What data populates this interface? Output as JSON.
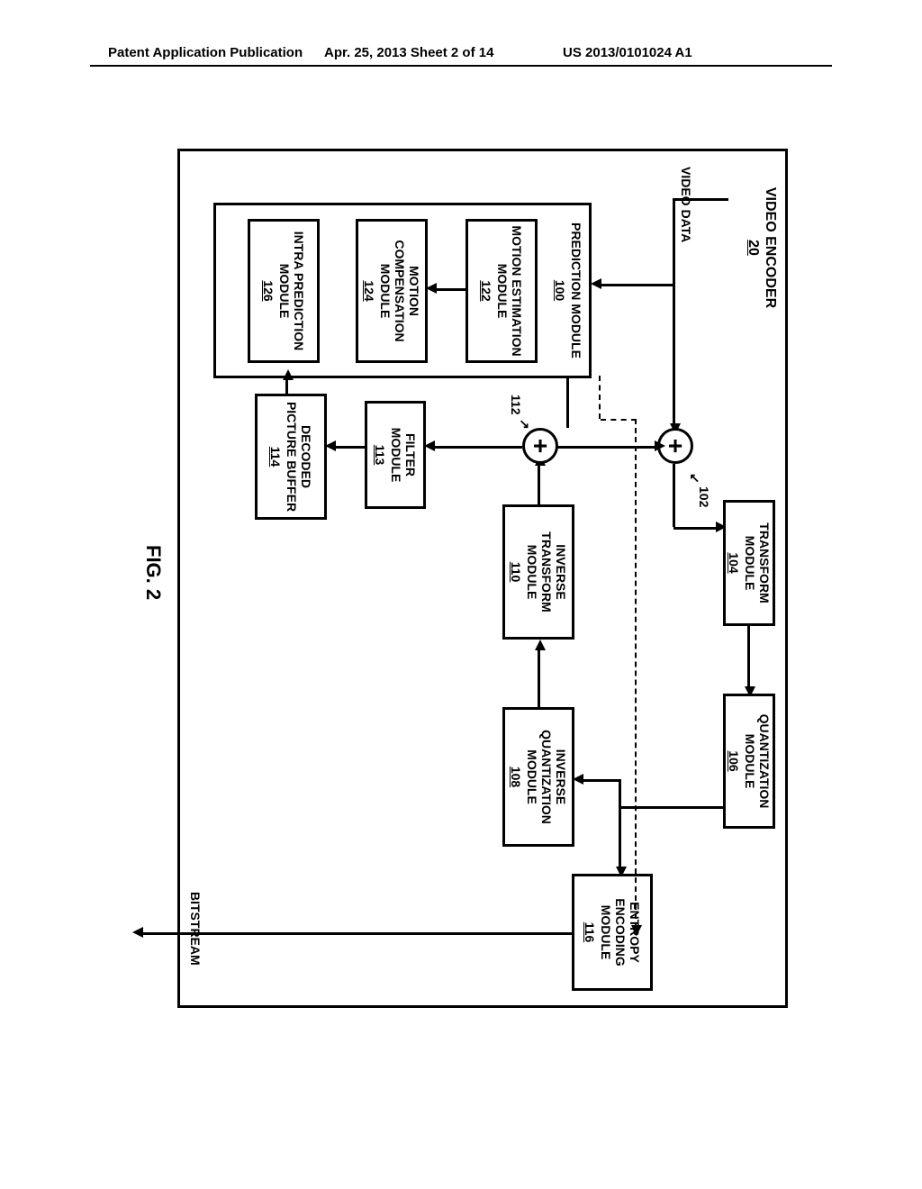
{
  "header": {
    "left": "Patent Application Publication",
    "center": "Apr. 25, 2013  Sheet 2 of 14",
    "right": "US 2013/0101024 A1"
  },
  "labels": {
    "video_data": "VIDEO DATA",
    "bitstream": "BITSTREAM",
    "s102": "102",
    "s112": "112"
  },
  "title": {
    "name": "VIDEO ENCODER",
    "num": "20"
  },
  "boxes": {
    "prediction": {
      "name": "PREDICTION MODULE",
      "num": "100"
    },
    "motion_est": {
      "name": "MOTION ESTIMATION MODULE",
      "num": "122"
    },
    "motion_comp": {
      "name": "MOTION COMPENSATION MODULE",
      "num": "124"
    },
    "intra_pred": {
      "name": "INTRA PREDICTION MODULE",
      "num": "126"
    },
    "transform": {
      "name": "TRANSFORM MODULE",
      "num": "104"
    },
    "quantization": {
      "name": "QUANTIZATION MODULE",
      "num": "106"
    },
    "inv_quantization": {
      "name": "INVERSE QUANTIZATION MODULE",
      "num": "108"
    },
    "inv_transform": {
      "name": "INVERSE TRANSFORM MODULE",
      "num": "110"
    },
    "entropy": {
      "name": "ENTROPY ENCODING MODULE",
      "num": "116"
    },
    "filter": {
      "name": "FILTER MODULE",
      "num": "113"
    },
    "dpb": {
      "name": "DECODED PICTURE BUFFER",
      "num": "114"
    }
  },
  "figure_caption": "FIG. 2"
}
